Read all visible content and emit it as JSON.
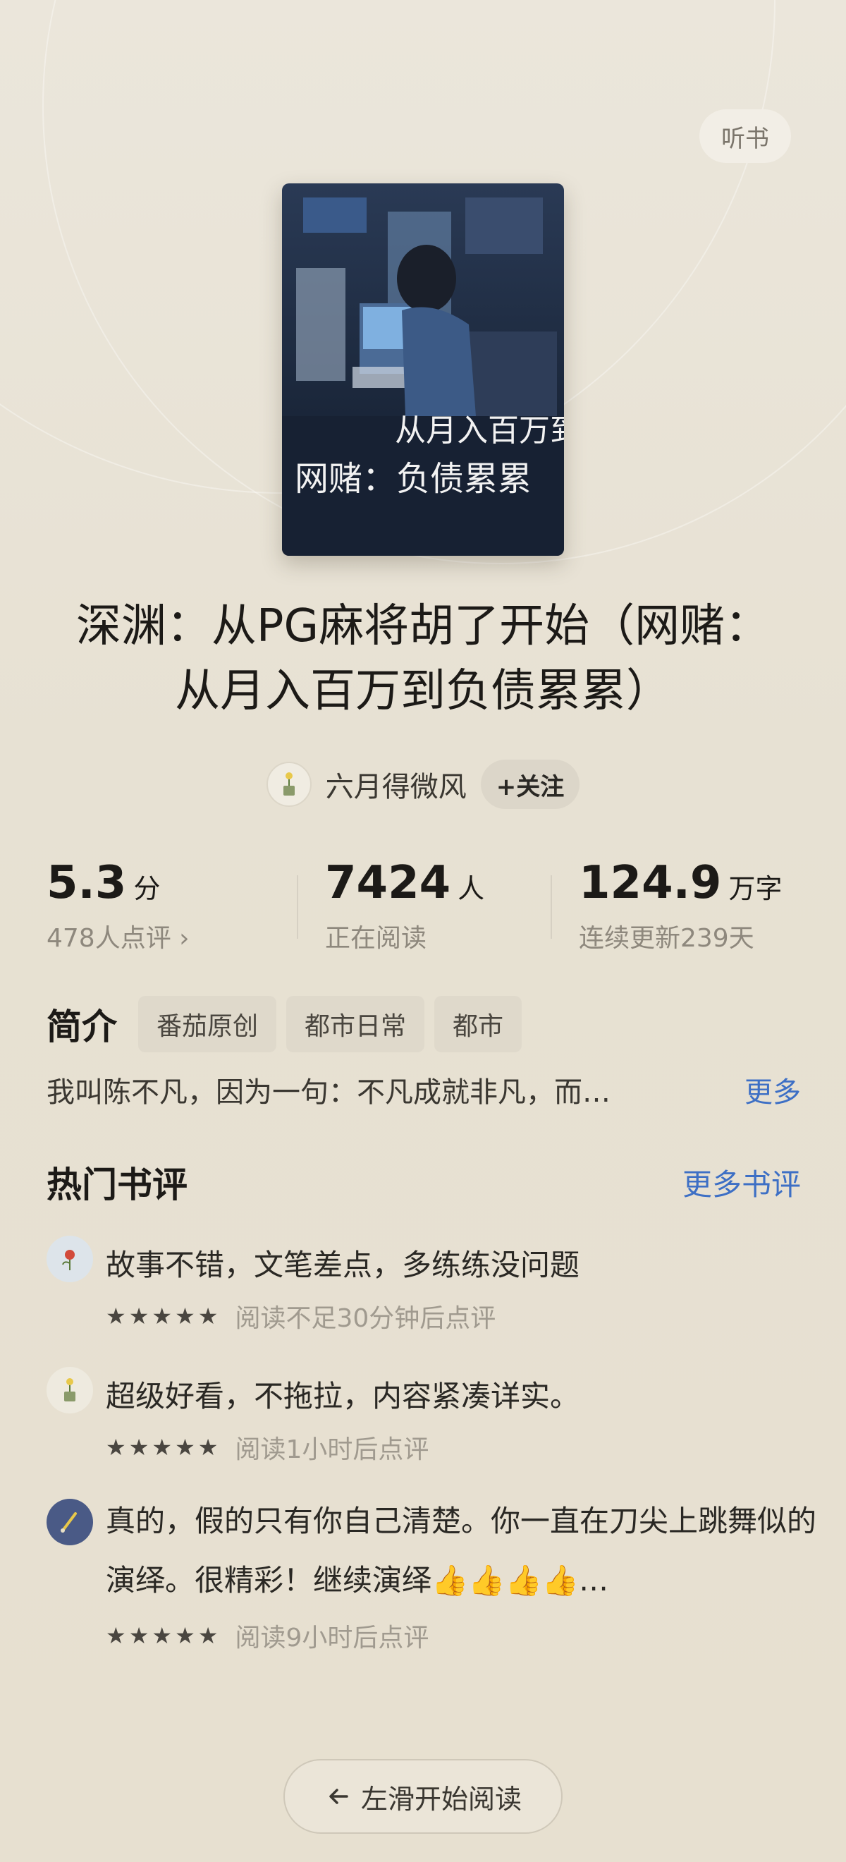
{
  "header": {
    "listen_label": "听书"
  },
  "book": {
    "cover_title_line1": "从月入百万到",
    "cover_title_line2": "网赌：负债累累",
    "title": "深渊：从PG麻将胡了开始（网赌：从月入百万到负债累累）"
  },
  "author": {
    "name": "六月得微风",
    "follow_label": "+关注",
    "avatar_icon": "potted-plant-icon"
  },
  "stats": [
    {
      "value": "5.3",
      "unit": "分",
      "sub": "478人点评 ›"
    },
    {
      "value": "7424",
      "unit": "人",
      "sub": "正在阅读"
    },
    {
      "value": "124.9",
      "unit": "万字",
      "sub": "连续更新239天"
    }
  ],
  "intro": {
    "label": "简介",
    "tags": [
      "番茄原创",
      "都市日常",
      "都市"
    ],
    "synopsis": "我叫陈不凡，因为一句：不凡成就非凡，而…",
    "more_label": "更多"
  },
  "reviews": {
    "title": "热门书评",
    "more_label": "更多书评",
    "items": [
      {
        "text": "故事不错，文笔差点，多练练没问题",
        "rating": 5,
        "time": "阅读不足30分钟后点评",
        "avatar_icon": "flower-icon"
      },
      {
        "text": "超级好看，不拖拉，内容紧凑详实。",
        "rating": 5,
        "time": "阅读1小时后点评",
        "avatar_icon": "potted-plant-icon"
      },
      {
        "text": "真的，假的只有你自己清楚。你一直在刀尖上跳舞似的演绎。很精彩！继续演绎👍👍👍👍…",
        "rating": 5,
        "time": "阅读9小时后点评",
        "avatar_icon": "pen-icon"
      }
    ]
  },
  "footer": {
    "start_label": "左滑开始阅读",
    "arrow_icon": "arrow-left-icon"
  },
  "colors": {
    "accent_link": "#3d6fc5",
    "background": "#e8e2d5"
  }
}
